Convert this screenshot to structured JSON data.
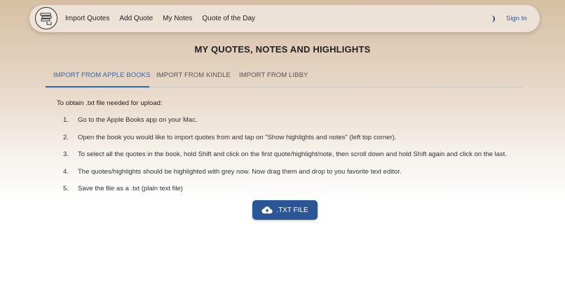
{
  "nav": {
    "links": [
      "Import Quotes",
      "Add Quote",
      "My Notes",
      "Quote of the Day"
    ],
    "theme_icon": "half-moon-icon",
    "signin_label": "Sign In"
  },
  "page_title": "MY QUOTES, NOTES AND HIGHLIGHTS",
  "tabs": [
    {
      "label": "IMPORT FROM APPLE BOOKS",
      "active": true
    },
    {
      "label": "IMPORT FROM KINDLE",
      "active": false
    },
    {
      "label": "IMPORT FROM LIBBY",
      "active": false
    }
  ],
  "instructions": {
    "intro": "To obtain .txt file needed for upload:",
    "steps": [
      {
        "num": "1.",
        "text": "Go to the Apple Books app on your Mac."
      },
      {
        "num": "2.",
        "text": "Open the book you would like to import quotes from and tap on \"Show highlights and notes\" (left top corner)."
      },
      {
        "num": "3.",
        "text": "To select all the quotes in the book, hold Shift and click on the first quote/highlight/note, then scroll down and hold Shift again and click on the last."
      },
      {
        "num": "4.",
        "text": "The quotes/highlights should be highlighted with grey now. Now drag them and drop to you favorite text editor."
      },
      {
        "num": "5.",
        "text": "Save the file as a .txt (plain text file)"
      }
    ]
  },
  "upload": {
    "label": ".TXT FILE",
    "icon": "cloud-upload-icon"
  },
  "colors": {
    "accent": "#2f66b0",
    "button": "#2a5597"
  }
}
